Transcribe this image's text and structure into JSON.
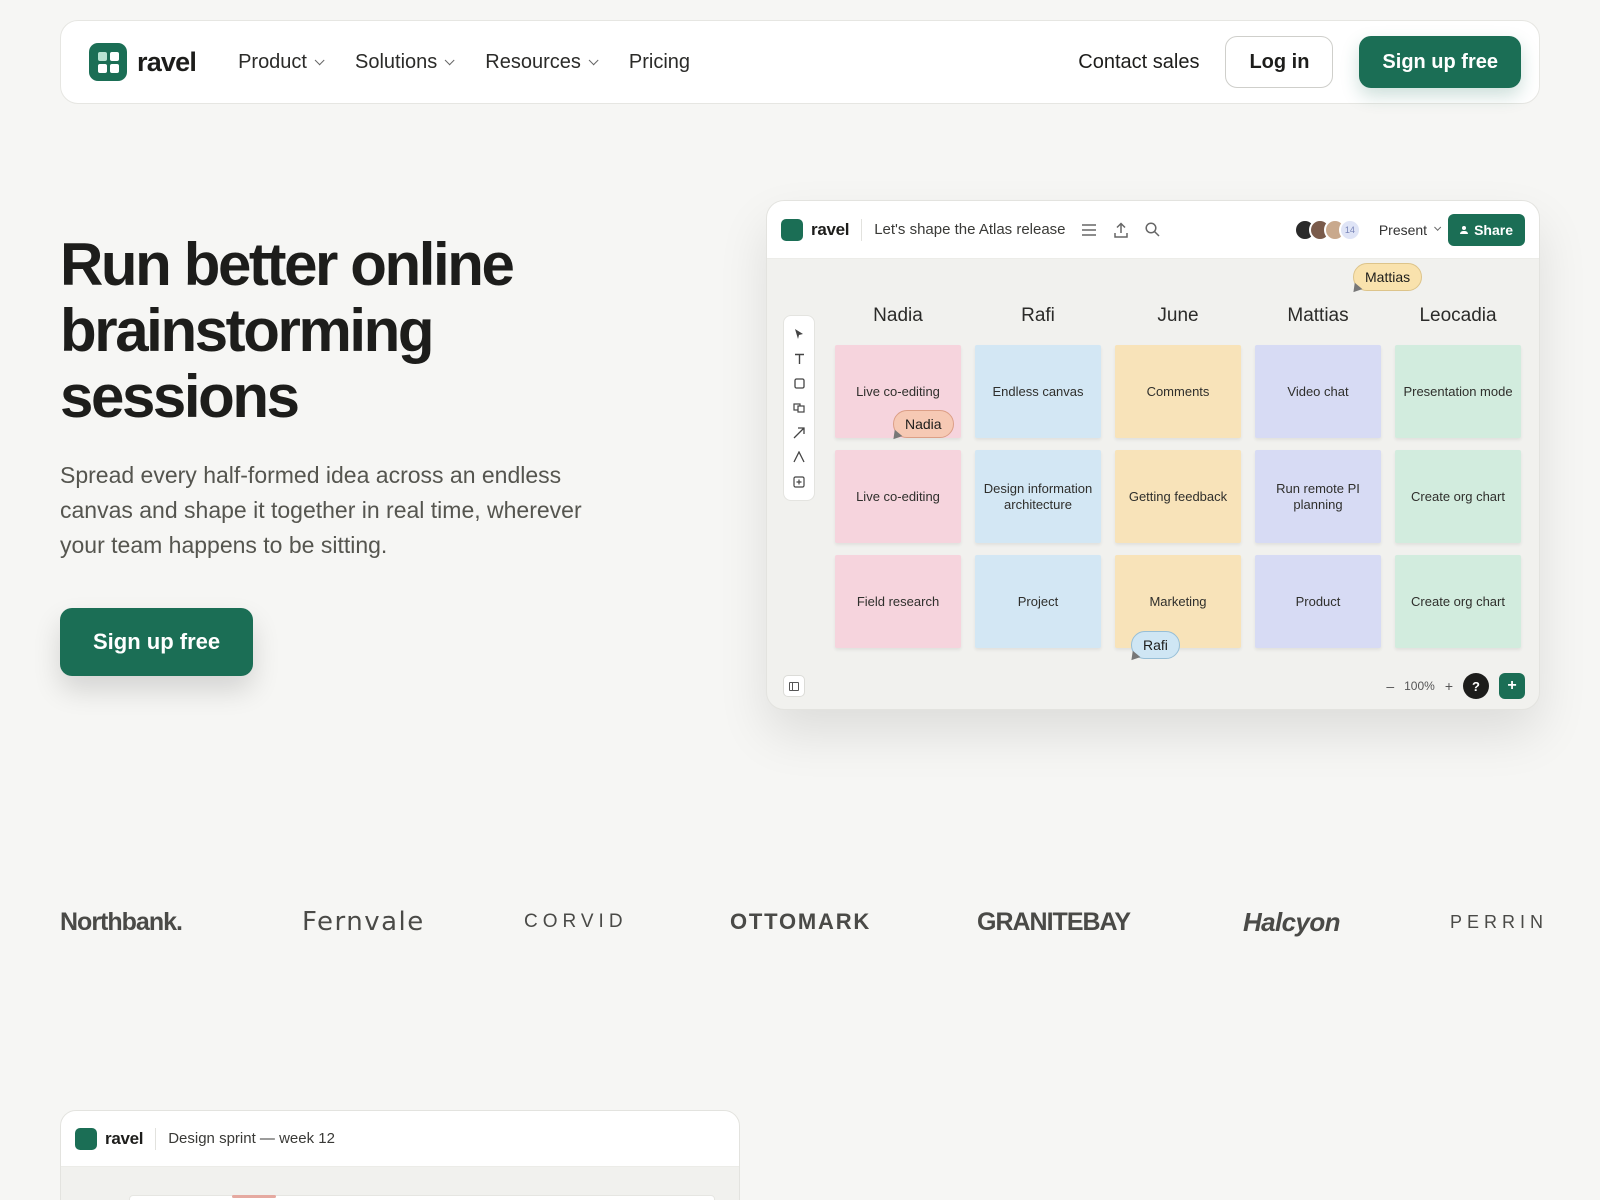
{
  "brand": {
    "name": "ravel",
    "accent": "#1b6e55"
  },
  "nav": {
    "items": [
      {
        "label": "Product",
        "dropdown": true
      },
      {
        "label": "Solutions",
        "dropdown": true
      },
      {
        "label": "Resources",
        "dropdown": true
      },
      {
        "label": "Pricing",
        "dropdown": false
      }
    ],
    "contact": "Contact sales",
    "login": "Log in",
    "signup": "Sign up free"
  },
  "hero": {
    "title": "Run better online brainstorming sessions",
    "subtitle": "Spread every half-formed idea across an endless canvas and shape it together in real time, wherever your team happens to be sitting.",
    "cta": "Sign up free"
  },
  "app": {
    "logo": "ravel",
    "board_title": "Let's shape the Atlas release",
    "collaborator_overflow": "14",
    "present_label": "Present",
    "share_label": "Share",
    "zoom": "100%",
    "zoom_minus": "–",
    "zoom_plus": "+",
    "help": "?",
    "add": "+",
    "columns": [
      {
        "name": "Nadia",
        "color": "#f6d4dd",
        "notes": [
          "Live co-editing",
          "Live co-editing",
          "Field research"
        ]
      },
      {
        "name": "Rafi",
        "color": "#d3e7f4",
        "notes": [
          "Endless canvas",
          "Design information architecture",
          "Project"
        ]
      },
      {
        "name": "June",
        "color": "#f8e3b9",
        "notes": [
          "Comments",
          "Getting feedback",
          "Marketing"
        ]
      },
      {
        "name": "Mattias",
        "color": "#d7dbf4",
        "notes": [
          "Video chat",
          "Run remote PI planning",
          "Product"
        ]
      },
      {
        "name": "Leocadia",
        "color": "#d2ecde",
        "notes": [
          "Presentation mode",
          "Create org chart",
          "Create org chart"
        ]
      }
    ],
    "cursors": {
      "mattias": "Mattias",
      "nadia": "Nadia",
      "rafi": "Rafi"
    },
    "tools": [
      "select-icon",
      "text-icon",
      "shape-icon",
      "sticky-icon",
      "arrow-icon",
      "pen-icon",
      "frame-icon"
    ]
  },
  "logos": [
    "Northbank.",
    "Fernvale",
    "CORVID",
    "OTTOMARK",
    "GRANITEBAY",
    "Halcyon",
    "PERRIN"
  ],
  "app2": {
    "logo": "ravel",
    "board_title": "Design sprint — week 12"
  }
}
